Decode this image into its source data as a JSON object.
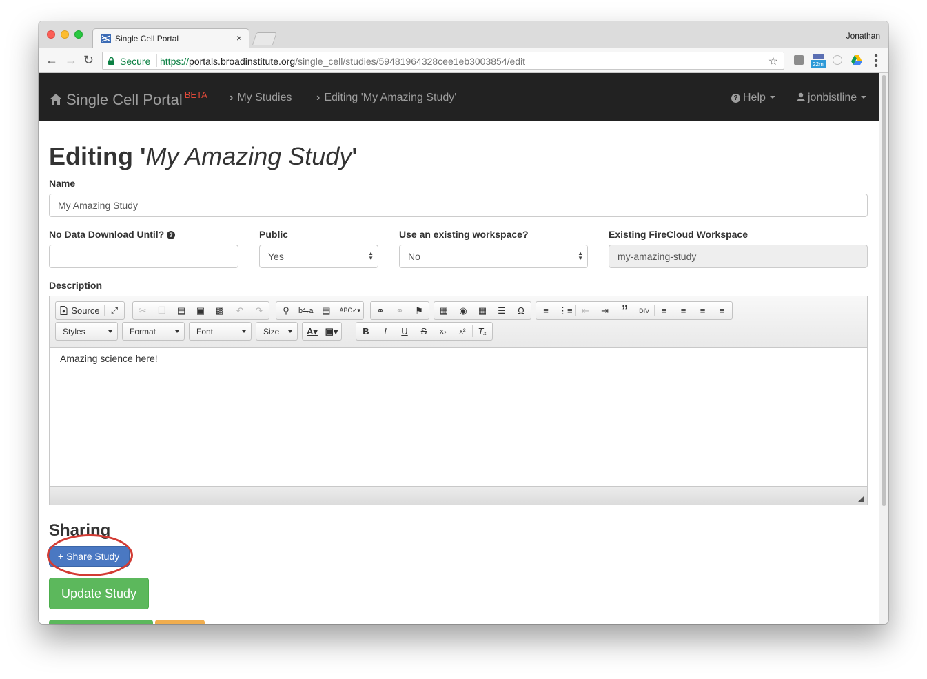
{
  "browser": {
    "tab_title": "Single Cell Portal",
    "tab_close": "×",
    "profile_name": "Jonathan",
    "secure_label": "Secure",
    "url_scheme": "https://",
    "url_host": "portals.broadinstitute.org",
    "url_path": "/single_cell/studies/59481964328cee1eb3003854/edit",
    "extension_badge": "22m",
    "icons": [
      "back-icon",
      "forward-icon",
      "reload-icon",
      "lock-icon",
      "star-icon",
      "menu-icon"
    ]
  },
  "navbar": {
    "brand": "Single Cell Portal",
    "beta": "BETA",
    "crumb_studies": "My Studies",
    "crumb_editing": "Editing 'My Amazing Study'",
    "help": "Help",
    "user": "jonbistline"
  },
  "page": {
    "title_prefix": "Editing '",
    "title_study": "My Amazing Study",
    "title_suffix": "'",
    "name_label": "Name",
    "name_value": "My Amazing Study",
    "download_label": "No Data Download Until?",
    "download_value": "",
    "public_label": "Public",
    "public_value": "Yes",
    "workspace_label": "Use an existing workspace?",
    "workspace_value": "No",
    "firecloud_label": "Existing FireCloud Workspace",
    "firecloud_value": "my-amazing-study",
    "description_label": "Description",
    "sharing_title": "Sharing",
    "share_button": "Share Study",
    "update_button": "Update Study"
  },
  "editor": {
    "source_label": "Source",
    "styles_combo": "Styles",
    "format_combo": "Format",
    "font_combo": "Font",
    "size_combo": "Size",
    "content": "Amazing science here!"
  },
  "colors": {
    "navbar_bg": "#222222",
    "beta": "#e04a3a",
    "share_button": "#4a78c2",
    "update_button": "#5cb85c",
    "annotation_circle": "#d23b33",
    "secure_green": "#0b8043"
  }
}
